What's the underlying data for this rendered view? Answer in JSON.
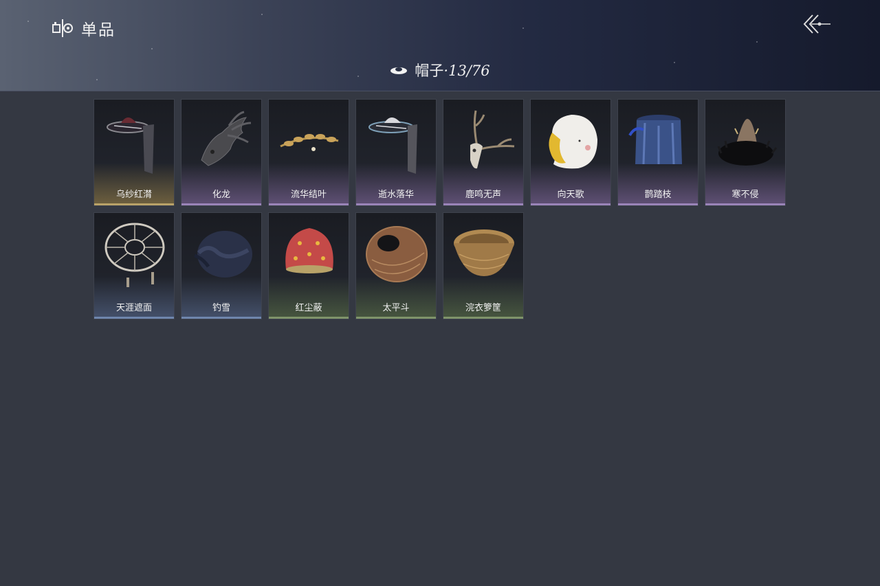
{
  "header": {
    "section_title": "单品",
    "back_icon": "back-arrow-icon"
  },
  "category": {
    "icon": "hat-icon",
    "name": "帽子",
    "separator": "·",
    "count": "13/76"
  },
  "items": [
    {
      "name": "乌纱红潸",
      "rarity": "gold",
      "icon": "veiled-hat-icon"
    },
    {
      "name": "化龙",
      "rarity": "purple",
      "icon": "dragon-head-icon"
    },
    {
      "name": "流华结叶",
      "rarity": "purple",
      "icon": "leaf-crown-icon"
    },
    {
      "name": "逝水落华",
      "rarity": "purple",
      "icon": "veiled-hat-icon"
    },
    {
      "name": "鹿鸣无声",
      "rarity": "purple",
      "icon": "deer-skull-icon"
    },
    {
      "name": "向天歌",
      "rarity": "purple",
      "icon": "goose-hood-icon"
    },
    {
      "name": "鹊踏枝",
      "rarity": "purple",
      "icon": "blue-veil-icon"
    },
    {
      "name": "寒不侵",
      "rarity": "purple",
      "icon": "fur-hat-icon"
    },
    {
      "name": "天涯遮面",
      "rarity": "blue",
      "icon": "bamboo-frame-hat-icon"
    },
    {
      "name": "钓雪",
      "rarity": "blue",
      "icon": "dark-wrap-hat-icon"
    },
    {
      "name": "红尘蔽",
      "rarity": "green",
      "icon": "red-hood-icon"
    },
    {
      "name": "太平斗",
      "rarity": "green",
      "icon": "woven-hat-icon"
    },
    {
      "name": "浣衣箩筐",
      "rarity": "green",
      "icon": "basket-icon"
    }
  ]
}
